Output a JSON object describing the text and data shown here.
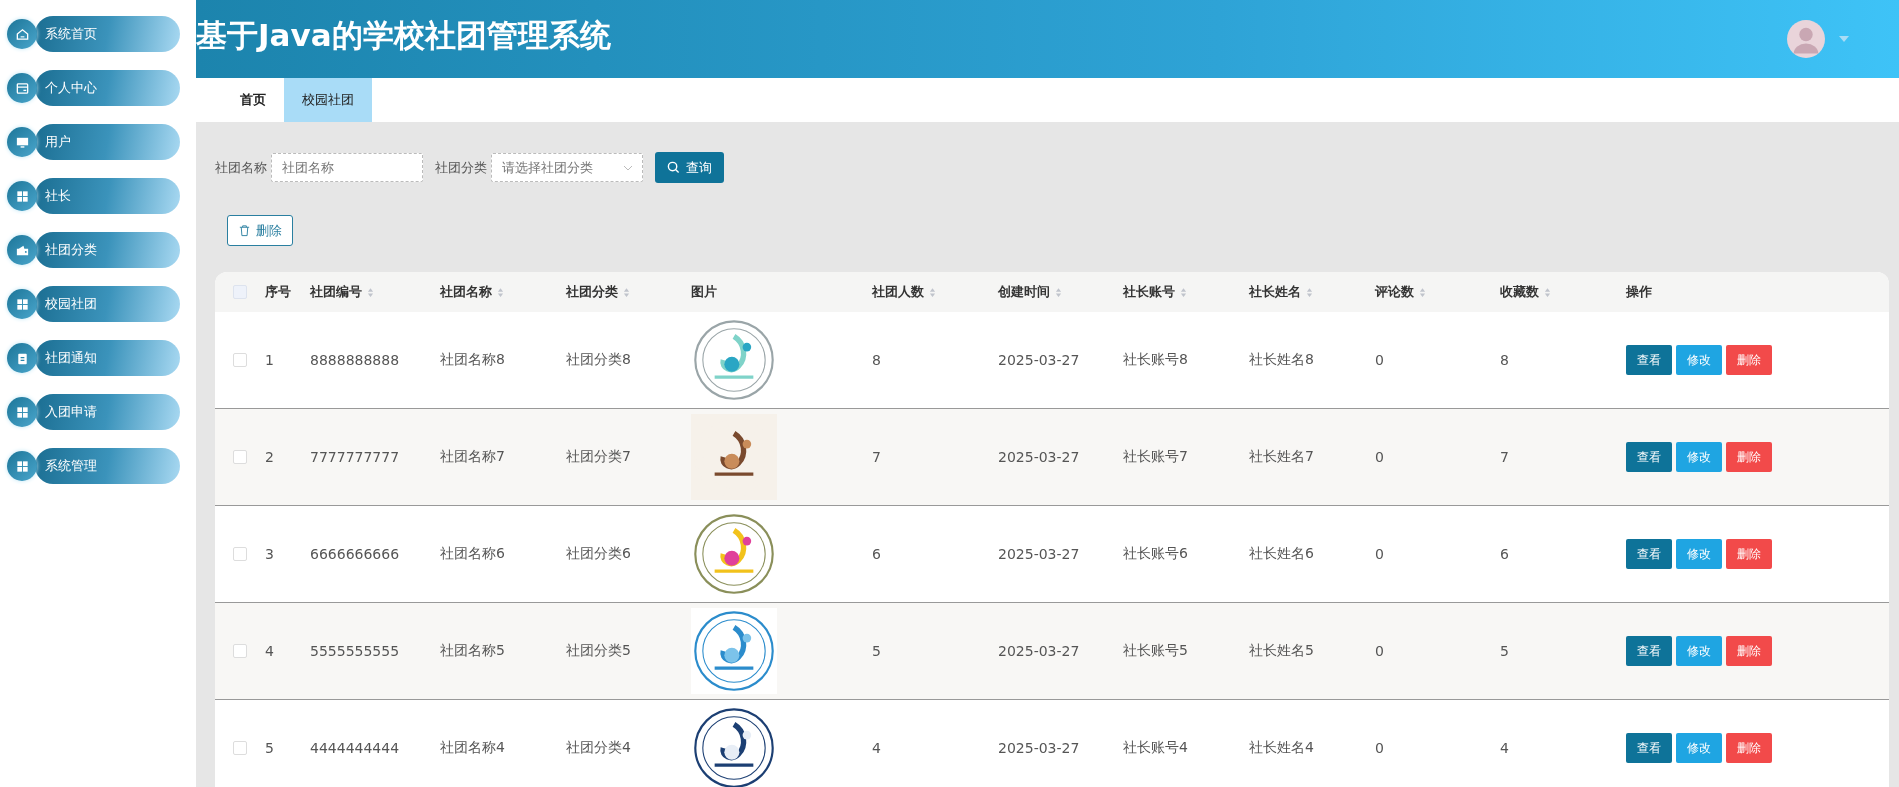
{
  "sidebar": {
    "items": [
      {
        "label": "系统首页"
      },
      {
        "label": "个人中心"
      },
      {
        "label": "用户"
      },
      {
        "label": "社长"
      },
      {
        "label": "社团分类"
      },
      {
        "label": "校园社团"
      },
      {
        "label": "社团通知"
      },
      {
        "label": "入团申请"
      },
      {
        "label": "系统管理"
      }
    ]
  },
  "header": {
    "title": "基于Java的学校社团管理系统"
  },
  "tabs": [
    {
      "label": "首页",
      "selected": false
    },
    {
      "label": "校园社团",
      "selected": true
    }
  ],
  "search": {
    "fields": [
      {
        "label": "社团名称",
        "placeholder": "社团名称",
        "kind": "input"
      },
      {
        "label": "社团分类",
        "placeholder": "请选择社团分类",
        "kind": "select"
      }
    ],
    "button": "查询"
  },
  "delete_button": "删除",
  "table": {
    "select_all_checked": false,
    "columns": [
      {
        "label": "序号",
        "sortable": false
      },
      {
        "label": "社团编号",
        "sortable": true
      },
      {
        "label": "社团名称",
        "sortable": true
      },
      {
        "label": "社团分类",
        "sortable": true
      },
      {
        "label": "图片",
        "sortable": false
      },
      {
        "label": "社团人数",
        "sortable": true
      },
      {
        "label": "创建时间",
        "sortable": true
      },
      {
        "label": "社长账号",
        "sortable": true
      },
      {
        "label": "社长姓名",
        "sortable": true
      },
      {
        "label": "评论数",
        "sortable": true
      },
      {
        "label": "收藏数",
        "sortable": true
      },
      {
        "label": "操作",
        "sortable": false
      }
    ],
    "rows": [
      {
        "checked": false,
        "cells": [
          "1",
          "8888888888",
          "社团名称8",
          "社团分类8",
          {
            "kind": "picture"
          },
          "8",
          "2025-03-27",
          "社长账号8",
          "社长姓名8",
          "0",
          "8"
        ],
        "actions": [
          {
            "label": "查看",
            "kind": "view"
          },
          {
            "label": "修改",
            "kind": "edit"
          },
          {
            "label": "删除",
            "kind": "delete"
          }
        ]
      },
      {
        "checked": false,
        "cells": [
          "2",
          "7777777777",
          "社团名称7",
          "社团分类7",
          {
            "kind": "picture"
          },
          "7",
          "2025-03-27",
          "社长账号7",
          "社长姓名7",
          "0",
          "7"
        ],
        "actions": [
          {
            "label": "查看",
            "kind": "view"
          },
          {
            "label": "修改",
            "kind": "edit"
          },
          {
            "label": "删除",
            "kind": "delete"
          }
        ]
      },
      {
        "checked": false,
        "cells": [
          "3",
          "6666666666",
          "社团名称6",
          "社团分类6",
          {
            "kind": "picture"
          },
          "6",
          "2025-03-27",
          "社长账号6",
          "社长姓名6",
          "0",
          "6"
        ],
        "actions": [
          {
            "label": "查看",
            "kind": "view"
          },
          {
            "label": "修改",
            "kind": "edit"
          },
          {
            "label": "删除",
            "kind": "delete"
          }
        ]
      },
      {
        "checked": false,
        "cells": [
          "4",
          "5555555555",
          "社团名称5",
          "社团分类5",
          {
            "kind": "picture"
          },
          "5",
          "2025-03-27",
          "社长账号5",
          "社长姓名5",
          "0",
          "5"
        ],
        "actions": [
          {
            "label": "查看",
            "kind": "view"
          },
          {
            "label": "修改",
            "kind": "edit"
          },
          {
            "label": "删除",
            "kind": "delete"
          }
        ]
      },
      {
        "checked": false,
        "cells": [
          "5",
          "4444444444",
          "社团名称4",
          "社团分类4",
          {
            "kind": "picture"
          },
          "4",
          "2025-03-27",
          "社长账号4",
          "社长姓名4",
          "0",
          "4"
        ],
        "actions": [
          {
            "label": "查看",
            "kind": "view"
          },
          {
            "label": "修改",
            "kind": "edit"
          },
          {
            "label": "删除",
            "kind": "delete"
          }
        ]
      }
    ]
  }
}
